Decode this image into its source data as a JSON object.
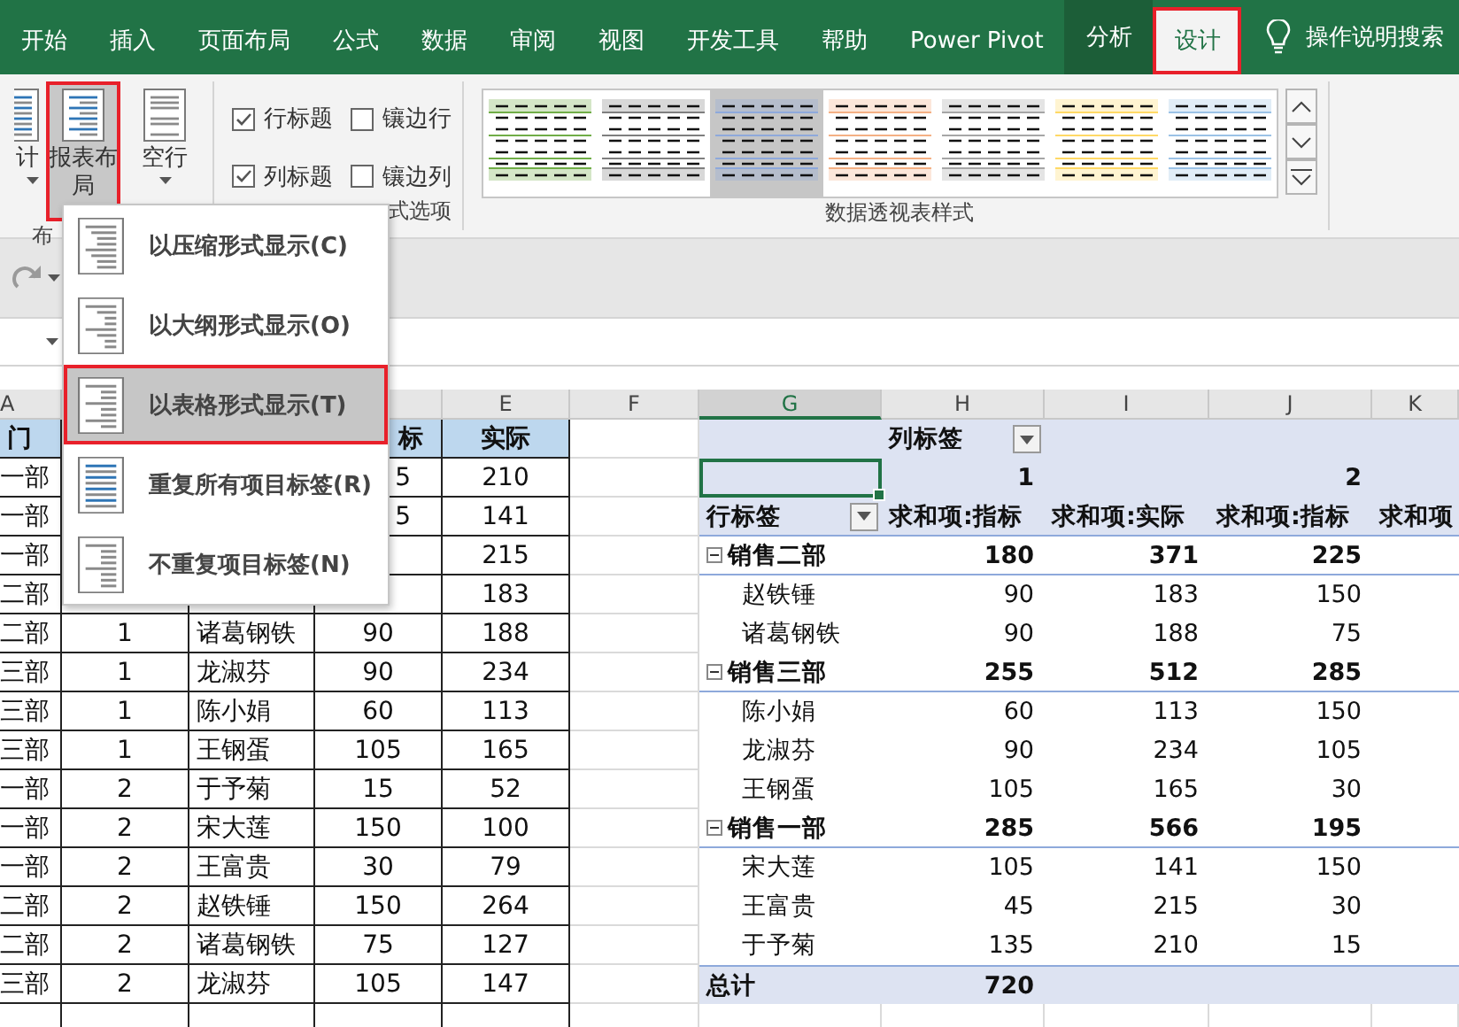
{
  "ribbon_tabs": [
    {
      "label": "开始",
      "selected": false,
      "contextual": false,
      "highlighted": false
    },
    {
      "label": "插入",
      "selected": false,
      "contextual": false,
      "highlighted": false
    },
    {
      "label": "页面布局",
      "selected": false,
      "contextual": false,
      "highlighted": false
    },
    {
      "label": "公式",
      "selected": false,
      "contextual": false,
      "highlighted": false
    },
    {
      "label": "数据",
      "selected": false,
      "contextual": false,
      "highlighted": false
    },
    {
      "label": "审阅",
      "selected": false,
      "contextual": false,
      "highlighted": false
    },
    {
      "label": "视图",
      "selected": false,
      "contextual": false,
      "highlighted": false
    },
    {
      "label": "开发工具",
      "selected": false,
      "contextual": false,
      "highlighted": false
    },
    {
      "label": "帮助",
      "selected": false,
      "contextual": false,
      "highlighted": false
    },
    {
      "label": "Power Pivot",
      "selected": false,
      "contextual": false,
      "highlighted": false
    },
    {
      "label": "分析",
      "selected": false,
      "contextual": true,
      "highlighted": false
    },
    {
      "label": "设计",
      "selected": true,
      "contextual": true,
      "highlighted": true
    }
  ],
  "tell_me": "操作说明搜索",
  "layout_group": {
    "label": "布",
    "buttons": [
      {
        "label": "计",
        "kind": "subtotals",
        "selected": false,
        "highlighted": false
      },
      {
        "label": "报表布局",
        "kind": "report",
        "selected": true,
        "highlighted": true
      },
      {
        "label": "空行",
        "kind": "blank_rows",
        "selected": false,
        "highlighted": false
      }
    ]
  },
  "style_options": {
    "label": "式选项",
    "items": [
      {
        "label": "行标题",
        "checked": true
      },
      {
        "label": "镶边行",
        "checked": false
      },
      {
        "label": "列标题",
        "checked": true
      },
      {
        "label": "镶边列",
        "checked": false
      }
    ]
  },
  "pivot_styles": {
    "label": "数据透视表样式",
    "items": [
      {
        "color": "#70ad47",
        "selected": false
      },
      {
        "color": "#7f7f7f",
        "selected": false
      },
      {
        "color": "#8ea9db",
        "selected": true
      },
      {
        "color": "#f4b084",
        "selected": false
      },
      {
        "color": "#a6a6a6",
        "selected": false
      },
      {
        "color": "#ffd966",
        "selected": false
      },
      {
        "color": "#9bc2e6",
        "selected": false
      }
    ]
  },
  "layout_menu": [
    {
      "label": "以压缩形式显示(C)",
      "kind": "compact",
      "selected": false,
      "highlighted": false
    },
    {
      "label": "以大纲形式显示(O)",
      "kind": "outline",
      "selected": false,
      "highlighted": false
    },
    {
      "label": "以表格形式显示(T)",
      "kind": "tabular",
      "selected": true,
      "highlighted": true
    },
    {
      "label": "重复所有项目标签(R)",
      "kind": "repeat",
      "selected": false,
      "highlighted": false
    },
    {
      "label": "不重复项目标签(N)",
      "kind": "no_repeat",
      "selected": false,
      "highlighted": false
    }
  ],
  "column_headers": [
    {
      "label": "A",
      "selected": false
    },
    {
      "label": "E",
      "selected": false
    },
    {
      "label": "F",
      "selected": false
    },
    {
      "label": "G",
      "selected": true
    },
    {
      "label": "H",
      "selected": false
    },
    {
      "label": "I",
      "selected": false
    },
    {
      "label": "J",
      "selected": false
    },
    {
      "label": "K",
      "selected": false
    }
  ],
  "table": {
    "header": {
      "dept": "门",
      "target": "标",
      "actual": "实际"
    },
    "rows": [
      {
        "dept": "一部",
        "target": "5",
        "actual": "210"
      },
      {
        "dept": "一部",
        "target": "5",
        "actual": "141"
      },
      {
        "dept": "一部",
        "actual": "215"
      },
      {
        "dept": "二部",
        "actual": "183"
      },
      {
        "dept": "二部",
        "round": "1",
        "name": "诸葛钢铁",
        "target": "90",
        "actual": "188"
      },
      {
        "dept": "三部",
        "round": "1",
        "name": "龙淑芬",
        "target": "90",
        "actual": "234"
      },
      {
        "dept": "三部",
        "round": "1",
        "name": "陈小娟",
        "target": "60",
        "actual": "113"
      },
      {
        "dept": "三部",
        "round": "1",
        "name": "王钢蛋",
        "target": "105",
        "actual": "165"
      },
      {
        "dept": "一部",
        "round": "2",
        "name": "于予菊",
        "target": "15",
        "actual": "52"
      },
      {
        "dept": "一部",
        "round": "2",
        "name": "宋大莲",
        "target": "150",
        "actual": "100"
      },
      {
        "dept": "一部",
        "round": "2",
        "name": "王富贵",
        "target": "30",
        "actual": "79"
      },
      {
        "dept": "二部",
        "round": "2",
        "name": "赵铁锤",
        "target": "150",
        "actual": "264"
      },
      {
        "dept": "二部",
        "round": "2",
        "name": "诸葛钢铁",
        "target": "75",
        "actual": "127"
      },
      {
        "dept": "三部",
        "round": "2",
        "name": "龙淑芬",
        "target": "105",
        "actual": "147"
      }
    ]
  },
  "pivot": {
    "column_caption": "列标签",
    "column_values": [
      "1",
      "2"
    ],
    "row_caption": "行标签",
    "corner_selected": true,
    "value_headers": [
      "求和项:指标",
      "求和项:实际",
      "求和项:指标",
      "求和项"
    ],
    "groups": [
      {
        "label": "销售二部",
        "expanded": true,
        "values": [
          "180",
          "371",
          "225"
        ],
        "children": [
          {
            "label": "赵铁锤",
            "values": [
              "90",
              "183",
              "150"
            ]
          },
          {
            "label": "诸葛钢铁",
            "values": [
              "90",
              "188",
              "75"
            ]
          }
        ]
      },
      {
        "label": "销售三部",
        "expanded": true,
        "values": [
          "255",
          "512",
          "285"
        ],
        "children": [
          {
            "label": "陈小娟",
            "values": [
              "60",
              "113",
              "150"
            ]
          },
          {
            "label": "龙淑芬",
            "values": [
              "90",
              "234",
              "105"
            ]
          },
          {
            "label": "王钢蛋",
            "values": [
              "105",
              "165",
              "30"
            ]
          }
        ]
      },
      {
        "label": "销售一部",
        "expanded": true,
        "values": [
          "285",
          "566",
          "195"
        ],
        "children": [
          {
            "label": "宋大莲",
            "values": [
              "105",
              "141",
              "150"
            ]
          },
          {
            "label": "王富贵",
            "values": [
              "45",
              "215",
              "30"
            ]
          },
          {
            "label": "于予菊",
            "values": [
              "135",
              "210",
              "15"
            ]
          }
        ]
      }
    ],
    "total": {
      "label": "总计",
      "values": [
        "720"
      ]
    }
  }
}
